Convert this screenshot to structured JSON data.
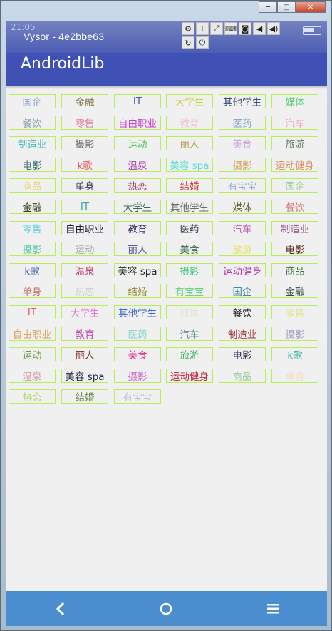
{
  "window": {
    "controls": {
      "minimize": "─",
      "maximize": "□",
      "close": "✕"
    }
  },
  "statusbar": {
    "time": "21:05",
    "vysor_title": "Vysor  -  4e2bbe63",
    "tools_row1": [
      "gear-icon",
      "pin-icon",
      "fullscreen-icon",
      "keyboard-icon",
      "camera-icon",
      "volume-down-icon",
      "volume-up-icon"
    ],
    "tools_row1_glyphs": [
      "⚙",
      "⊤",
      "⤢",
      "⌨",
      "◙",
      "◀",
      "◀)"
    ],
    "tools_row2": [
      "rotate-icon",
      "power-icon"
    ],
    "tools_row2_glyphs": [
      "↻",
      "⏻"
    ]
  },
  "appbar": {
    "title": "AndroidLib"
  },
  "tags": [
    {
      "text": "国企",
      "color": "#8fa3d6"
    },
    {
      "text": "金融",
      "color": "#7a6a3a"
    },
    {
      "text": "IT",
      "color": "#4a5a9e"
    },
    {
      "text": "大学生",
      "color": "#c8d23a"
    },
    {
      "text": "其他学生",
      "color": "#3a4a7a"
    },
    {
      "text": "媒体",
      "color": "#5ad07a"
    },
    {
      "text": "餐饮",
      "color": "#8aa0a8"
    },
    {
      "text": "零售",
      "color": "#e07aa0"
    },
    {
      "text": "自由职业",
      "color": "#c93bd0"
    },
    {
      "text": "教育",
      "color": "#f0c0d8"
    },
    {
      "text": "医药",
      "color": "#8aa8c8"
    },
    {
      "text": "汽车",
      "color": "#f0a8b8"
    },
    {
      "text": "制造业",
      "color": "#3ab8b8"
    },
    {
      "text": "摄影",
      "color": "#6a6a6a"
    },
    {
      "text": "运动",
      "color": "#5ac85a"
    },
    {
      "text": "丽人",
      "color": "#b89a4a"
    },
    {
      "text": "美食",
      "color": "#c8a0d8"
    },
    {
      "text": "旅游",
      "color": "#5a7a5a"
    },
    {
      "text": "电影",
      "color": "#3a6a6a"
    },
    {
      "text": "k歌",
      "color": "#e05a5a"
    },
    {
      "text": "温泉",
      "color": "#b03ab0"
    },
    {
      "text": "美容 spa",
      "color": "#5ae0d0"
    },
    {
      "text": "摄影",
      "color": "#d0a050"
    },
    {
      "text": "运动健身",
      "color": "#e0906a"
    },
    {
      "text": "商品",
      "color": "#e8d060"
    },
    {
      "text": "单身",
      "color": "#3a3a5a"
    },
    {
      "text": "热恋",
      "color": "#a03a6a"
    },
    {
      "text": "结婚",
      "color": "#d03a3a"
    },
    {
      "text": "有宝宝",
      "color": "#8ab0d0"
    },
    {
      "text": "国企",
      "color": "#9ad09a"
    },
    {
      "text": "金融",
      "color": "#3a3a1a"
    },
    {
      "text": "IT",
      "color": "#3aa0a0"
    },
    {
      "text": "大学生",
      "color": "#3a6a5a"
    },
    {
      "text": "其他学生",
      "color": "#6a6a6a"
    },
    {
      "text": "媒体",
      "color": "#6a5a2a"
    },
    {
      "text": "餐饮",
      "color": "#d07a7a"
    },
    {
      "text": "零售",
      "color": "#6ad0e8"
    },
    {
      "text": "自由职业",
      "color": "#1a1a3a"
    },
    {
      "text": "教育",
      "color": "#3a2a6a"
    },
    {
      "text": "医药",
      "color": "#2a3a4a"
    },
    {
      "text": "汽车",
      "color": "#c05ab0"
    },
    {
      "text": "制造业",
      "color": "#9a5a8a"
    },
    {
      "text": "摄影",
      "color": "#5ac8a0"
    },
    {
      "text": "运动",
      "color": "#b0b0b0"
    },
    {
      "text": "丽人",
      "color": "#5a5aa0"
    },
    {
      "text": "美食",
      "color": "#3a6a4a"
    },
    {
      "text": "旅游",
      "color": "#e8e070"
    },
    {
      "text": "电影",
      "color": "#5a2a1a"
    },
    {
      "text": "k歌",
      "color": "#3a5aa0"
    },
    {
      "text": "温泉",
      "color": "#c83a6a"
    },
    {
      "text": "美容 spa",
      "color": "#1a2a1a"
    },
    {
      "text": "摄影",
      "color": "#3ac87a"
    },
    {
      "text": "运动健身",
      "color": "#b02ab0"
    },
    {
      "text": "商品",
      "color": "#3a7a3a"
    },
    {
      "text": "单身",
      "color": "#c8706a"
    },
    {
      "text": "热恋",
      "color": "#d0d0d0"
    },
    {
      "text": "结婚",
      "color": "#9a8a3a"
    },
    {
      "text": "有宝宝",
      "color": "#6ad08a"
    },
    {
      "text": "国企",
      "color": "#3a8aa0"
    },
    {
      "text": "金融",
      "color": "#3a4a4a"
    },
    {
      "text": "IT",
      "color": "#e05a5a"
    },
    {
      "text": "大学生",
      "color": "#e07ad0"
    },
    {
      "text": "其他学生",
      "color": "#3a6ac0"
    },
    {
      "text": "媒体",
      "color": "#e0e8d0"
    },
    {
      "text": "餐饮",
      "color": "#1a1a1a"
    },
    {
      "text": "零售",
      "color": "#e0e890"
    },
    {
      "text": "自由职业",
      "color": "#e0a05a"
    },
    {
      "text": "教育",
      "color": "#c03ab0"
    },
    {
      "text": "医药",
      "color": "#8ad0d0"
    },
    {
      "text": "汽车",
      "color": "#6a8a9a"
    },
    {
      "text": "制造业",
      "color": "#a03a3a"
    },
    {
      "text": "摄影",
      "color": "#a0a0c0"
    },
    {
      "text": "运动",
      "color": "#6a9a3a"
    },
    {
      "text": "丽人",
      "color": "#8a3a3a"
    },
    {
      "text": "美食",
      "color": "#e02a8a"
    },
    {
      "text": "旅游",
      "color": "#3ab05a"
    },
    {
      "text": "电影",
      "color": "#2a2a4a"
    },
    {
      "text": "k歌",
      "color": "#3ab0a0"
    },
    {
      "text": "温泉",
      "color": "#d0a0a0"
    },
    {
      "text": "美容 spa",
      "color": "#2a2a4a"
    },
    {
      "text": "摄影",
      "color": "#d06ad0"
    },
    {
      "text": "运动健身",
      "color": "#c02a3a"
    },
    {
      "text": "商品",
      "color": "#a0d0a0"
    },
    {
      "text": "单身",
      "color": "#f0e0c0"
    },
    {
      "text": "热恋",
      "color": "#a0d060"
    },
    {
      "text": "结婚",
      "color": "#6a8a4a"
    },
    {
      "text": "有宝宝",
      "color": "#c0c0d0"
    }
  ],
  "navbar": {
    "back_glyph": "‹",
    "home_glyph": "○",
    "menu_glyph": "≡"
  }
}
